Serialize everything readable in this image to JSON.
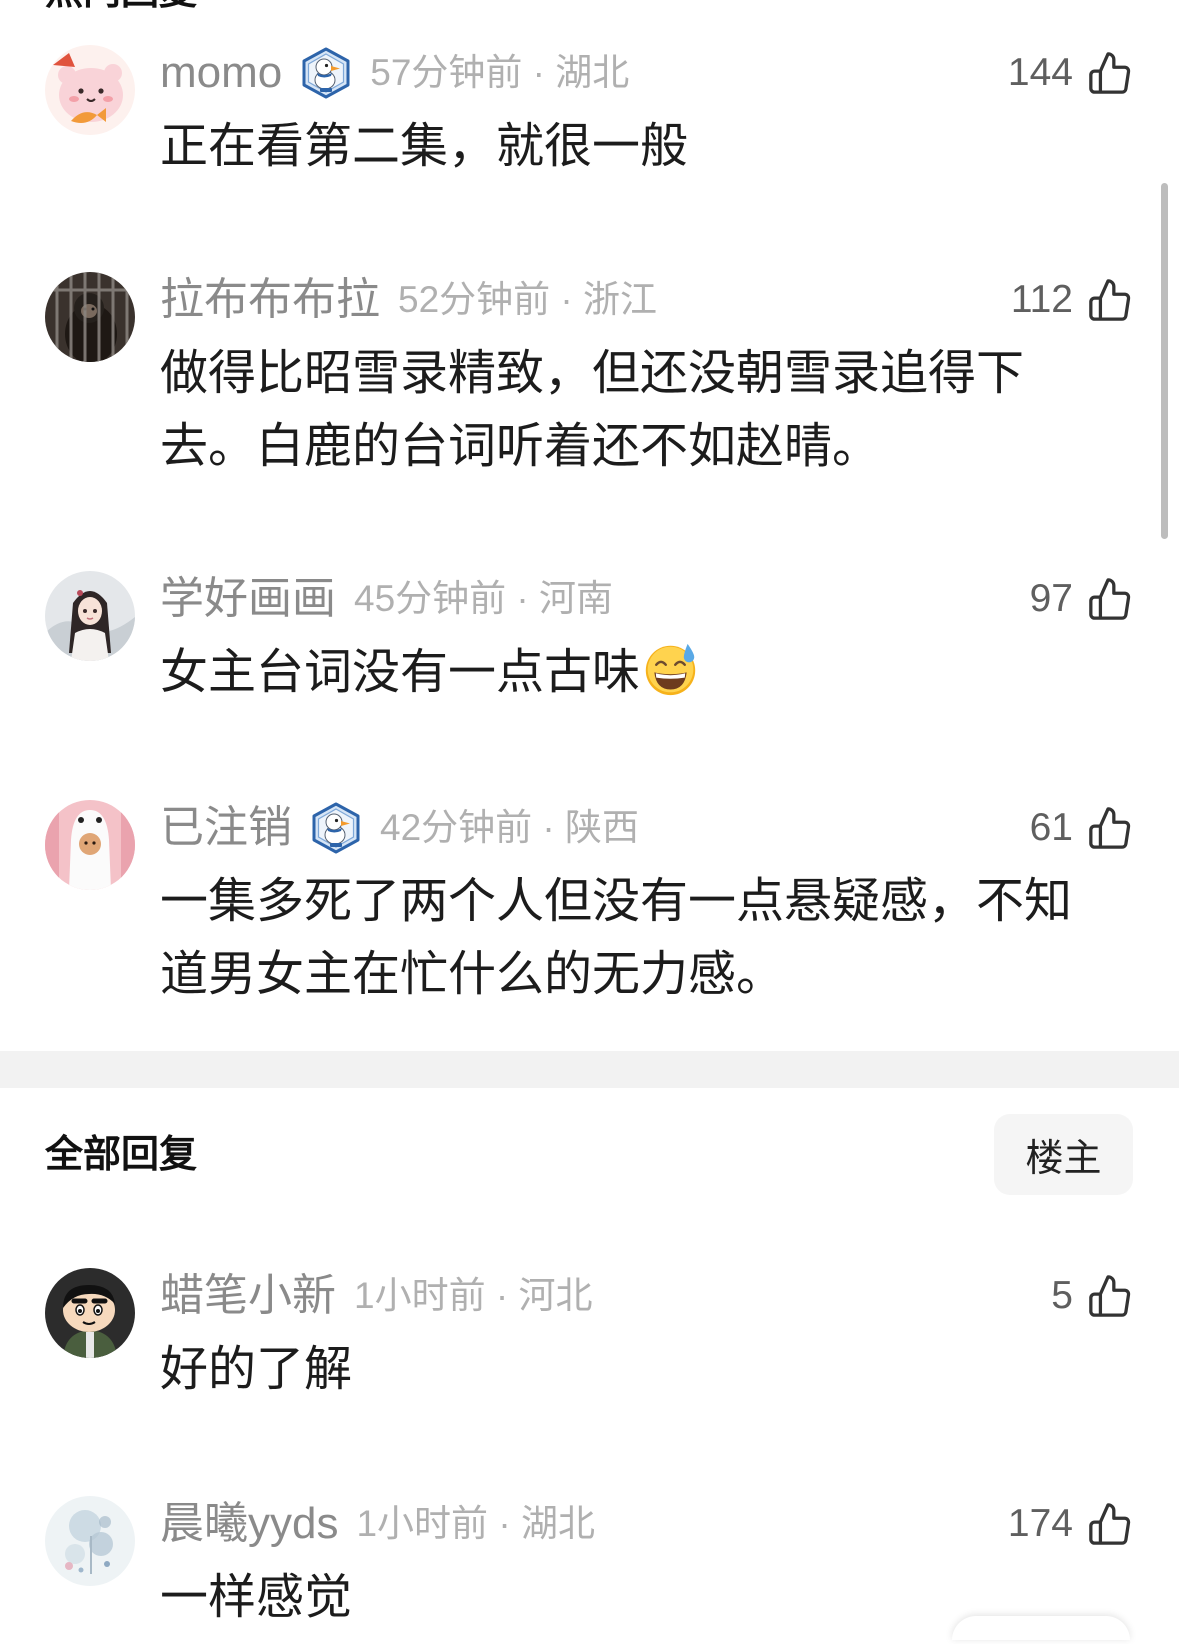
{
  "hot_replies": {
    "title": "热门回复"
  },
  "hot_comments": [
    {
      "username": "momo",
      "badge_icon": "goose-badge-icon",
      "meta": "57分钟前 · 湖北",
      "likes": 144,
      "lines": [
        "正在看第二集，就很一般"
      ]
    },
    {
      "username": "拉布布布拉",
      "meta": "52分钟前 · 浙江",
      "likes": 112,
      "lines": [
        "做得比昭雪录精致，但还没朝雪录追得下",
        "去。白鹿的台词听着还不如赵晴。"
      ]
    },
    {
      "username": "学好画画",
      "meta": "45分钟前 · 河南",
      "likes": 97,
      "lines": [
        "女主台词没有一点古味"
      ],
      "emoji_icon": "grinning-face-with-sweat-emoji"
    },
    {
      "username": "已注销",
      "badge_icon": "goose-badge-icon",
      "meta": "42分钟前 · 陕西",
      "likes": 61,
      "lines": [
        "一集多死了两个人但没有一点悬疑感，不知",
        "道男女主在忙什么的无力感。"
      ]
    }
  ],
  "all_replies": {
    "title": "全部回复",
    "filter_button": "楼主"
  },
  "all_comments": [
    {
      "username": "蜡笔小新",
      "meta": "1小时前 · 河北",
      "likes": 5,
      "lines": [
        "好的了解"
      ]
    },
    {
      "username": "晨曦yyds",
      "meta": "1小时前 · 湖北",
      "likes": 174,
      "lines": [
        "一样感觉"
      ]
    }
  ],
  "icons": {
    "like": "thumbs-up-icon",
    "badge": "goose-badge-icon"
  },
  "colors": {
    "username": "#8a8a8a",
    "meta": "#b0b0b0",
    "text": "#1c1c1c",
    "likes": "#5f5f5f",
    "separator": "#f2f2f2"
  }
}
